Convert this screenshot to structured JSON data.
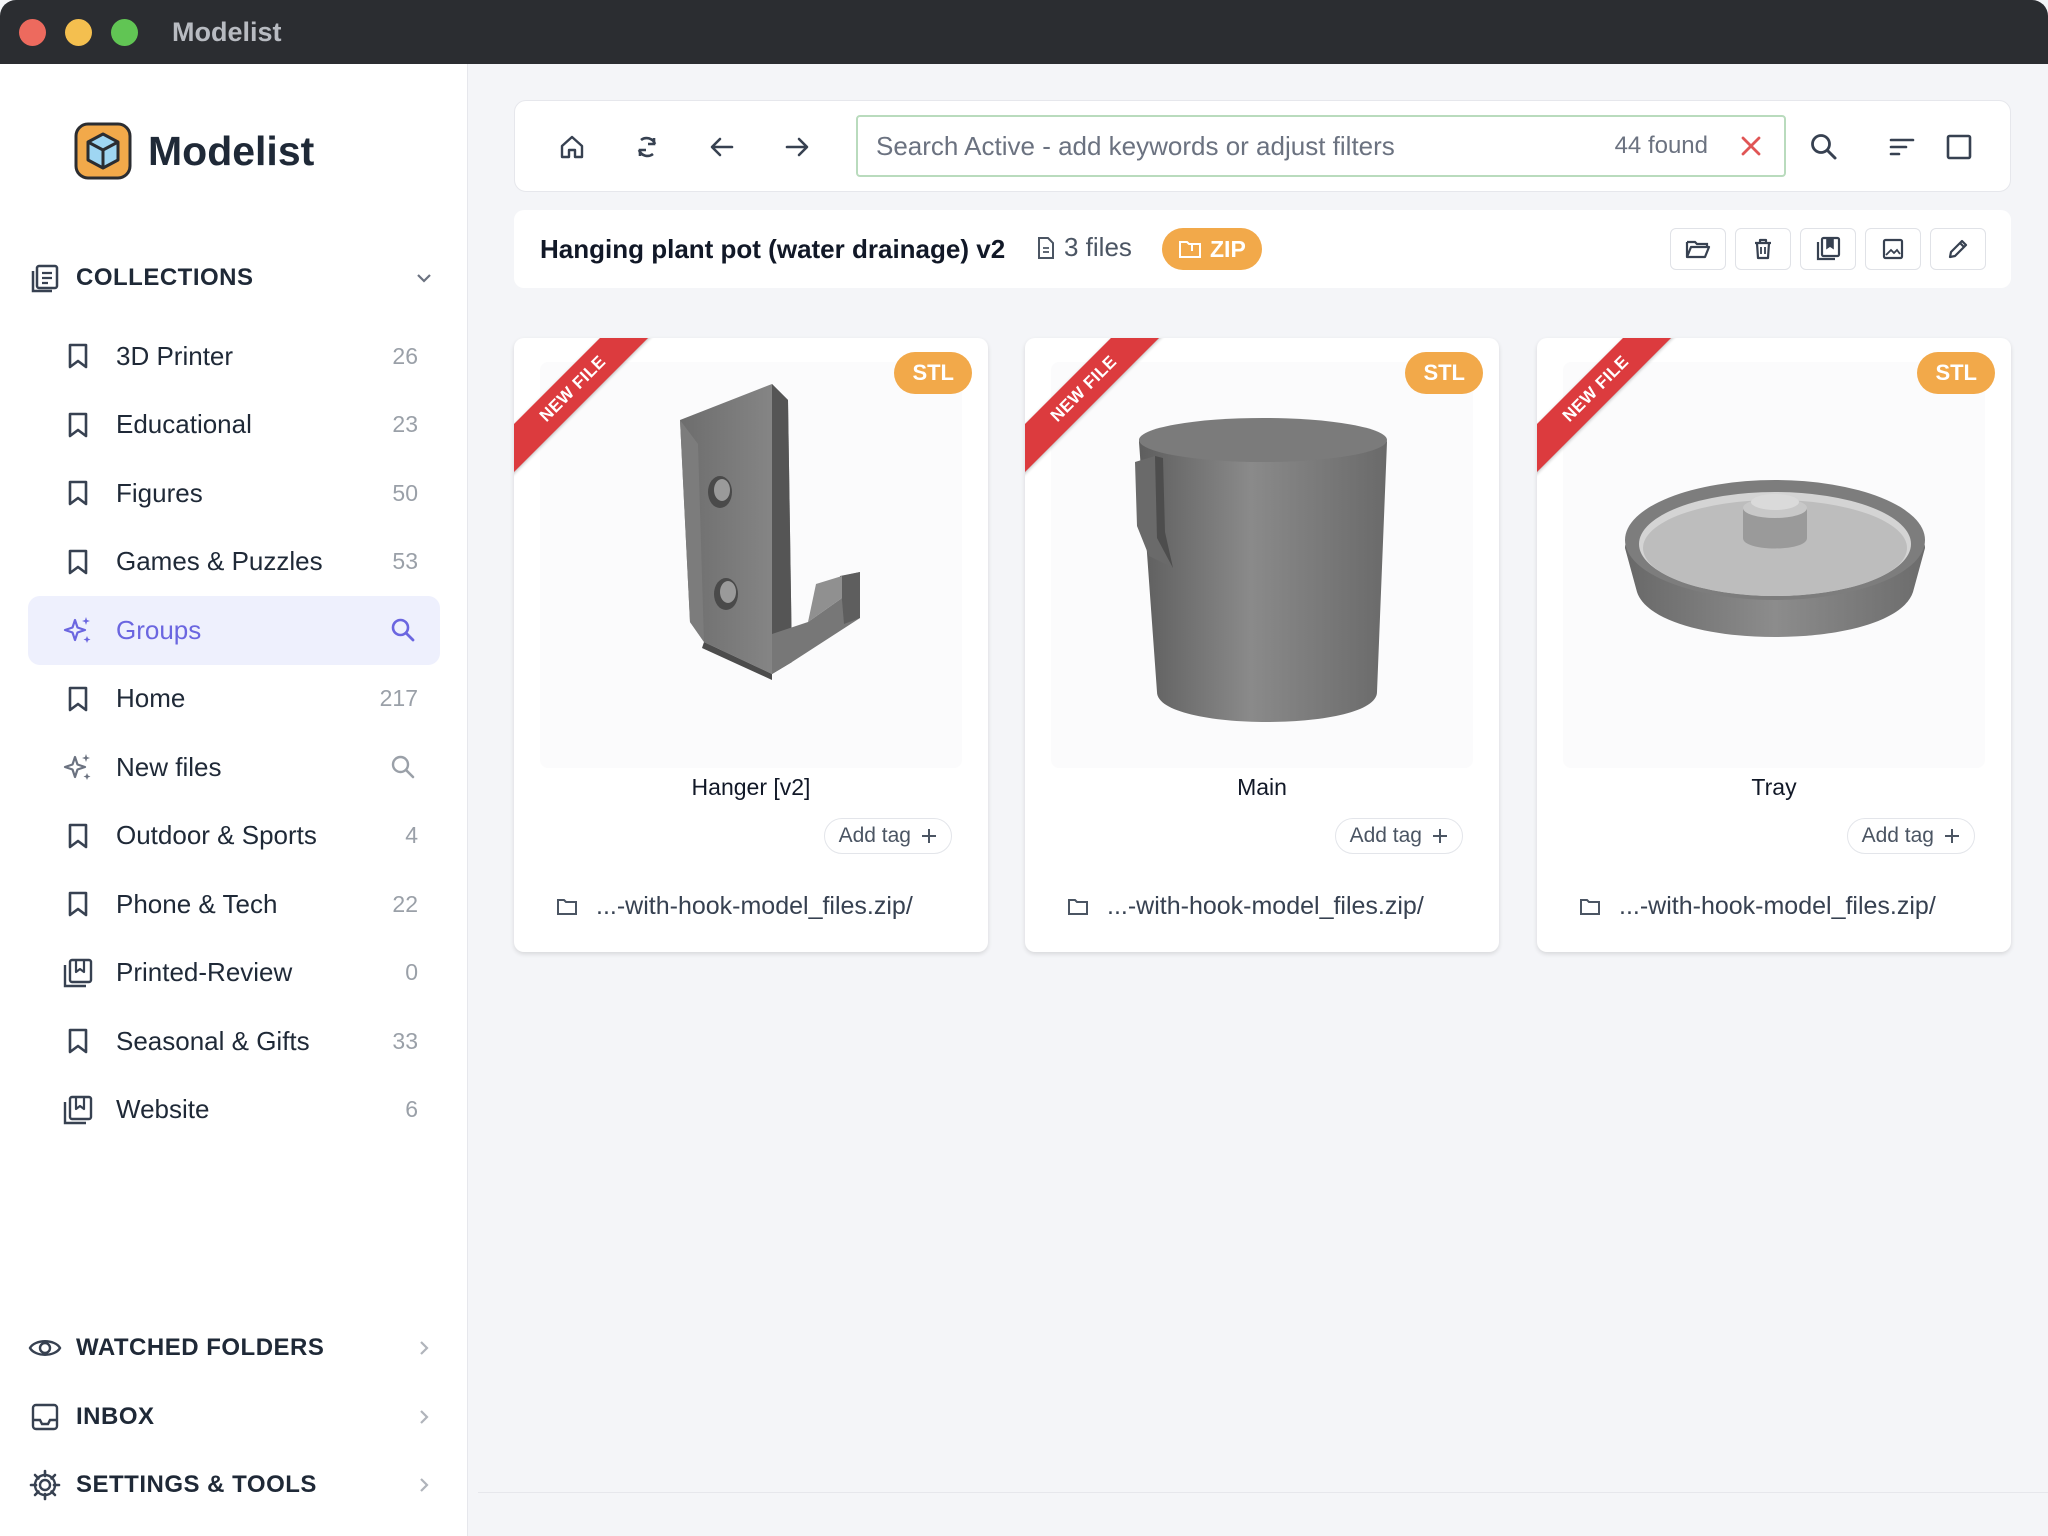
{
  "window": {
    "title": "Modelist"
  },
  "sidebar": {
    "brand": "Modelist",
    "collections_header": "COLLECTIONS",
    "collections": [
      {
        "label": "3D Printer",
        "count": "26",
        "icon": "bookmark-icon"
      },
      {
        "label": "Educational",
        "count": "23",
        "icon": "bookmark-icon"
      },
      {
        "label": "Figures",
        "count": "50",
        "icon": "bookmark-icon"
      },
      {
        "label": "Games & Puzzles",
        "count": "53",
        "icon": "bookmark-icon"
      },
      {
        "label": "Groups",
        "count": "",
        "icon": "sparkle-icon",
        "active": true
      },
      {
        "label": "Home",
        "count": "217",
        "icon": "bookmark-icon"
      },
      {
        "label": "New files",
        "count": "",
        "icon": "sparkle-icon"
      },
      {
        "label": "Outdoor & Sports",
        "count": "4",
        "icon": "bookmark-icon"
      },
      {
        "label": "Phone & Tech",
        "count": "22",
        "icon": "bookmark-icon"
      },
      {
        "label": "Printed-Review",
        "count": "0",
        "icon": "stack-bookmark-icon"
      },
      {
        "label": "Seasonal & Gifts",
        "count": "33",
        "icon": "bookmark-icon"
      },
      {
        "label": "Website",
        "count": "6",
        "icon": "stack-bookmark-icon"
      }
    ],
    "watched_folders": "WATCHED FOLDERS",
    "inbox": "INBOX",
    "settings": "SETTINGS & TOOLS"
  },
  "search": {
    "placeholder": "Search Active - add keywords or adjust filters",
    "found": "44 found"
  },
  "group": {
    "title": "Hanging plant pot (water drainage) v2",
    "files": "3 files",
    "zip": "ZIP"
  },
  "cards": [
    {
      "name": "Hanger [v2]",
      "format": "STL",
      "ribbon": "NEW FILE",
      "add_tag": "Add tag",
      "path": "...-with-hook-model_files.zip/"
    },
    {
      "name": "Main",
      "format": "STL",
      "ribbon": "NEW FILE",
      "add_tag": "Add tag",
      "path": "...-with-hook-model_files.zip/"
    },
    {
      "name": "Tray",
      "format": "STL",
      "ribbon": "NEW FILE",
      "add_tag": "Add tag",
      "path": "...-with-hook-model_files.zip/"
    }
  ],
  "colors": {
    "accent": "#6b66e0",
    "badge": "#f2a94a",
    "ribbon": "#dc3b3e",
    "clear": "#e05555"
  }
}
